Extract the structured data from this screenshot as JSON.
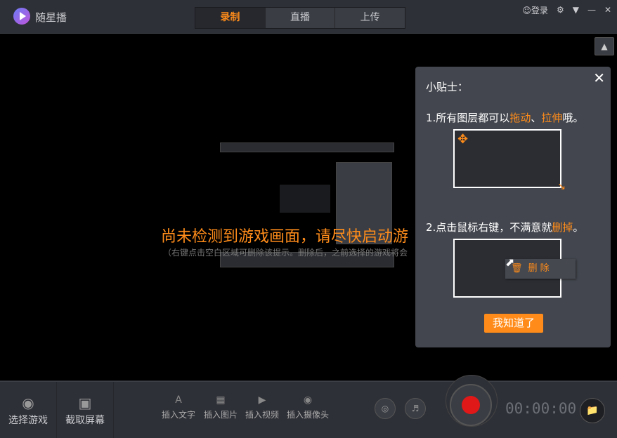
{
  "app": {
    "name": "随星播"
  },
  "tabs": [
    {
      "label": "录制"
    },
    {
      "label": "直播"
    },
    {
      "label": "上传"
    }
  ],
  "topright": {
    "login": "登录"
  },
  "stage": {
    "hint_main": "尚未检测到游戏画面，请尽快启动游",
    "hint_sub": "（右键点击空白区域可删除该提示。删除后，之前选择的游戏将会"
  },
  "tips": {
    "title": "小贴士：",
    "line1_prefix": "1.所有图层都可以",
    "line1_drag": "拖动",
    "line1_sep": "、",
    "line1_stretch": "拉伸",
    "line1_suffix": "哦。",
    "line2_prefix": "2.点击鼠标右键，不满意就",
    "line2_delete": "删掉",
    "line2_suffix": "。",
    "ctx_delete": "删 除",
    "confirm": "我知道了"
  },
  "bottombar": {
    "select_game": "选择游戏",
    "capture_screen": "截取屏幕",
    "insert_text": "插入文字",
    "insert_image": "插入图片",
    "insert_video": "插入视频",
    "insert_camera": "插入摄像头",
    "timer": "00:00:00"
  },
  "colors": {
    "accent": "#ff8c1a",
    "record": "#e01818"
  }
}
